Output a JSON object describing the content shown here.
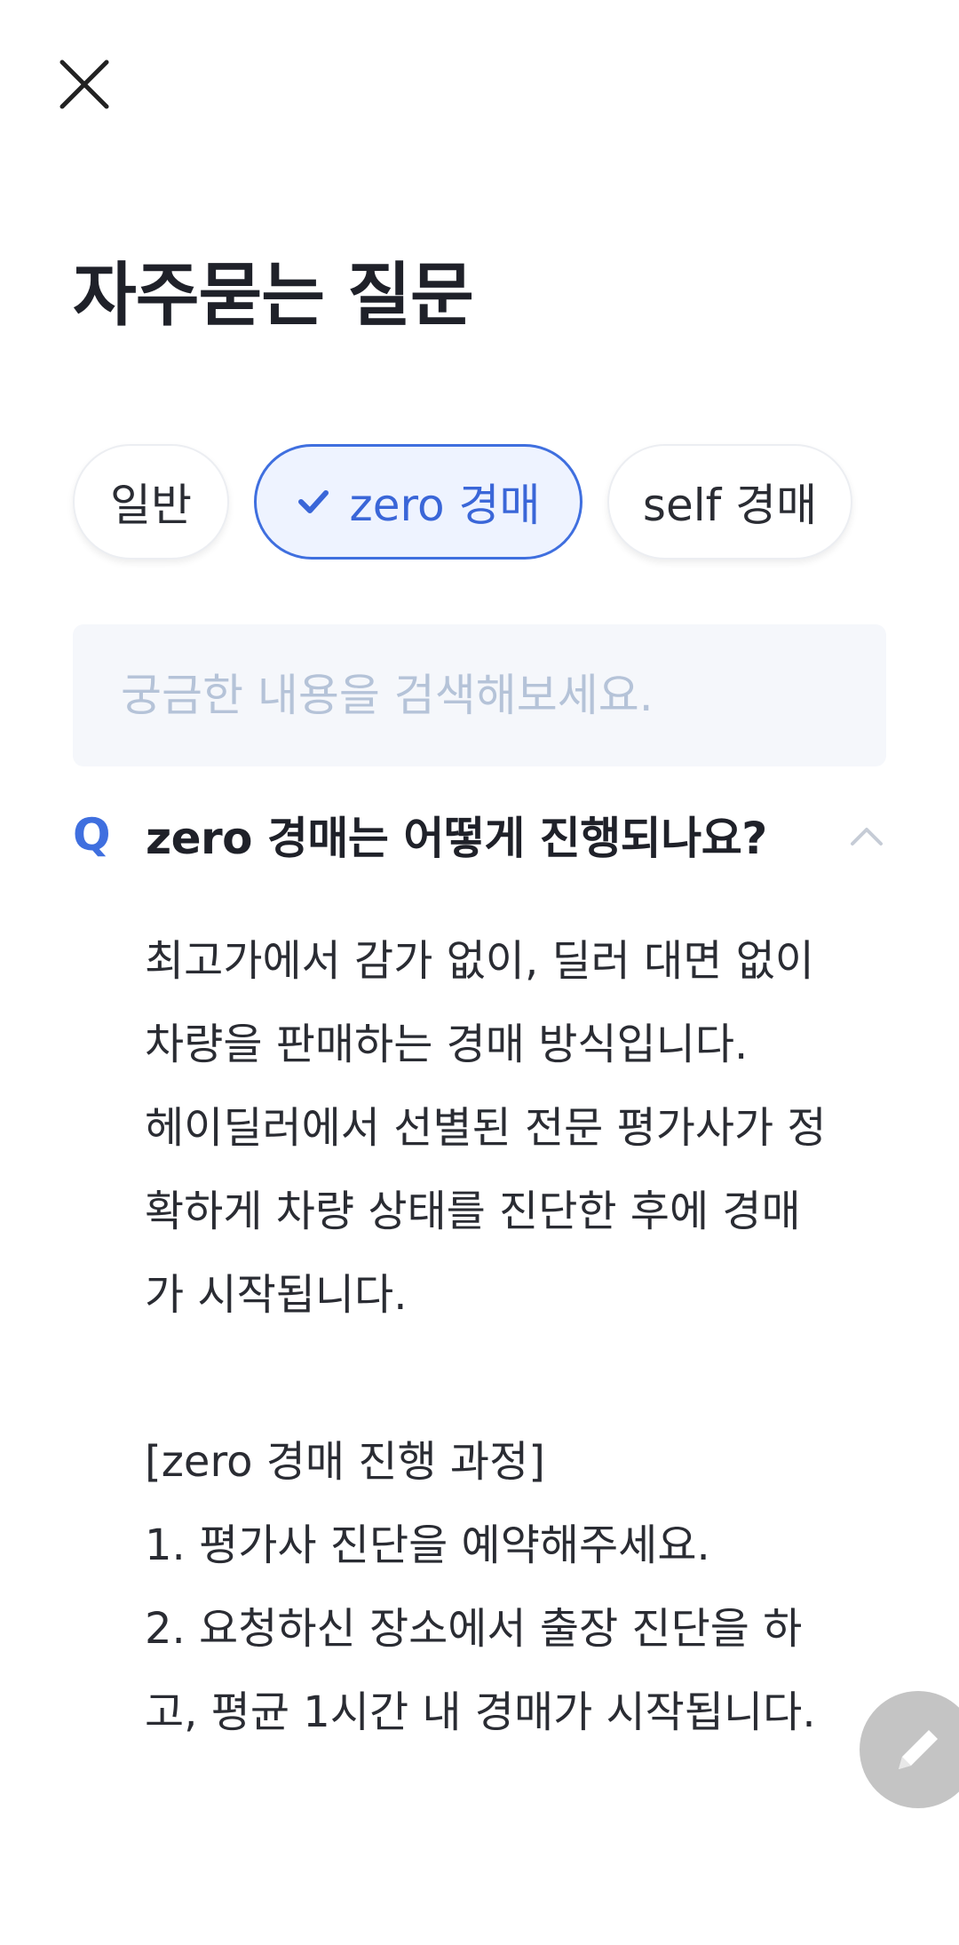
{
  "header": {
    "close_icon": "close-icon",
    "title": "자주묻는 질문"
  },
  "categories": [
    {
      "label": "일반",
      "selected": false
    },
    {
      "label": "zero 경매",
      "selected": true,
      "icon": "check-icon"
    },
    {
      "label": "self 경매",
      "selected": false
    }
  ],
  "search": {
    "placeholder": "궁금한 내용을 검색해보세요.",
    "value": ""
  },
  "faq": {
    "q_mark": "Q",
    "question": "zero 경매는 어떻게 진행되나요?",
    "expanded": true,
    "answer": "최고가에서 감가 없이, 딜러 대면 없이 차량을 판매하는 경매 방식입니다.\n헤이딜러에서 선별된 전문 평가사가 정확하게 차량 상태를 진단한 후에 경매가 시작됩니다.\n\n[zero 경매 진행 과정]\n1. 평가사 진단을 예약해주세요.\n2. 요청하신 장소에서 출장 진단을 하고, 평균 1시간 내 경매가 시작됩니다."
  },
  "fab": {
    "icon": "pencil-icon"
  },
  "colors": {
    "accent": "#3f6fdf",
    "chip_selected_bg": "#eef3ff",
    "search_bg": "#f5f7fb",
    "placeholder": "#b5c3d8",
    "fab_bg": "#c4c4c4"
  }
}
